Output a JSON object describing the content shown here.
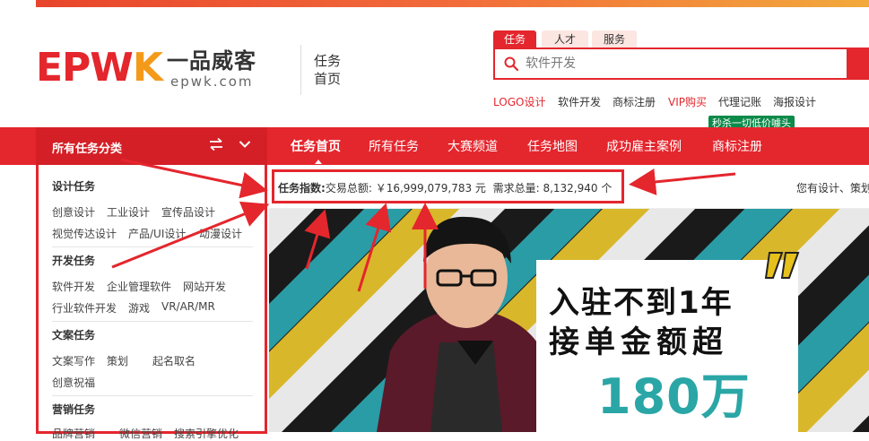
{
  "logo": {
    "letters": "EPWK",
    "name_cn": "一品威客",
    "url": "epwk.com",
    "sub": "任务首页"
  },
  "search": {
    "tabs": [
      "任务",
      "人才",
      "服务"
    ],
    "active_tab": "任务",
    "placeholder": "软件开发",
    "hot_links": [
      "LOGO设计",
      "软件开发",
      "商标注册",
      "VIP购买",
      "代理记账",
      "海报设计"
    ],
    "promo_badge": "秒杀一切低价噱头"
  },
  "nav": {
    "category_label": "所有任务分类",
    "items": [
      "任务首页",
      "所有任务",
      "大赛频道",
      "任务地图",
      "成功雇主案例",
      "商标注册"
    ],
    "active": "任务首页"
  },
  "index_bar": {
    "label": "任务指数:",
    "trade_label": "交易总额:",
    "trade_value": "￥16,999,079,783 元",
    "demand_label": "需求总量:",
    "demand_value": "8,132,940 个",
    "right_text": "您有设计、策划"
  },
  "categories": [
    {
      "title": "设计任务",
      "rows": [
        [
          "创意设计",
          "工业设计",
          "宣传品设计"
        ],
        [
          "视觉传达设计",
          "产品/UI设计",
          "动漫设计"
        ]
      ]
    },
    {
      "title": "开发任务",
      "rows": [
        [
          "软件开发",
          "企业管理软件",
          "网站开发"
        ],
        [
          "行业软件开发",
          "游戏",
          "VR/AR/MR"
        ]
      ]
    },
    {
      "title": "文案任务",
      "rows": [
        [
          "文案写作",
          "策划",
          "起名取名"
        ],
        [
          "创意祝福"
        ]
      ]
    },
    {
      "title": "营销任务",
      "rows": [
        [
          "品牌营销",
          "微信营销",
          "搜索引擎优化"
        ]
      ]
    }
  ],
  "banner": {
    "line1": "入驻不到1年",
    "line2": "接单金额超",
    "amount": "180万"
  },
  "colors": {
    "brand_red": "#e4262d",
    "logo_orange": "#f49a1b",
    "banner_teal": "#2aa6a6",
    "badge_green": "#0c8a4a"
  }
}
